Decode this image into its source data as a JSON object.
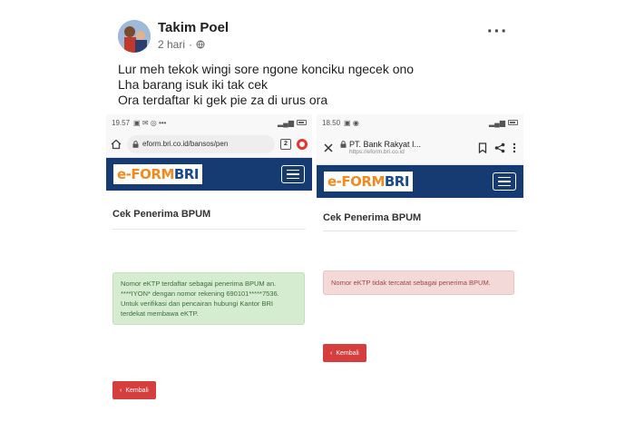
{
  "post": {
    "author": "Takim Poel",
    "time": "2 hari",
    "audience_icon": "globe-icon",
    "more_icon": "more-dots-icon",
    "lines": [
      "Lur meh tekok wingi sore ngone konciku ngecek ono",
      "Lha barang isuk iki tak cek",
      "Ora terdaftar ki gek pie za di urus ora"
    ]
  },
  "left_screen": {
    "status_time": "19.57",
    "url": "eform.bri.co.id/bansos/pen",
    "tab_count": "2",
    "logo_part1": "e-FORM",
    "logo_part2": "BRI",
    "heading": "Cek Penerima BPUM",
    "alert_text": "Nomor eKTP terdaftar sebagai penerima BPUM an. ****IYON* dengan nomor rekening 690101*****7536. Untuk verifikasi dan pencairan hubungi Kantor BRI terdekat membawa eKTP.",
    "back_label": "Kembali"
  },
  "right_screen": {
    "status_time": "18.50",
    "page_title": "PT. Bank Rakyat I...",
    "url": "https://eform.bri.co.id",
    "logo_part1": "e-FORM",
    "logo_part2": "BRI",
    "heading": "Cek Penerima BPUM",
    "alert_text": "Nomor eKTP tidak tercatat sebagai penerima BPUM.",
    "back_label": "Kembali"
  },
  "colors": {
    "brand_blue": "#163b73",
    "logo_orange": "#f18a1f",
    "success_bg": "#d6ecd0",
    "danger_bg": "#f4d9d9",
    "button_red": "#d63d3d"
  }
}
